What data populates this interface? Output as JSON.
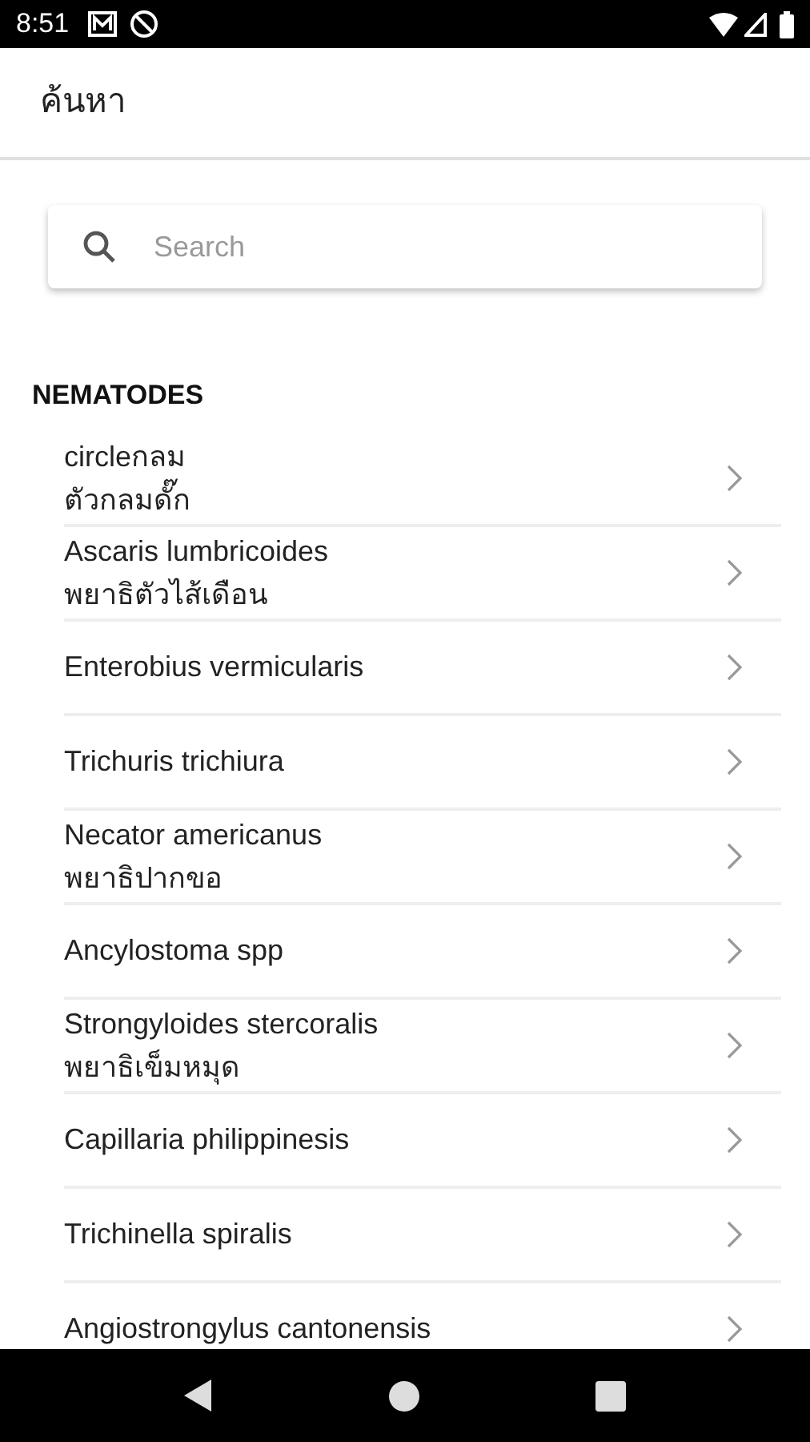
{
  "status_bar": {
    "time": "8:51"
  },
  "app_bar": {
    "title": "ค้นหา"
  },
  "search": {
    "placeholder": "Search"
  },
  "section": {
    "title": "NEMATODES"
  },
  "items": [
    {
      "title": "circleกลม",
      "subtitle": "ตัวกลมดั๊ก"
    },
    {
      "title": "Ascaris lumbricoides",
      "subtitle": "พยาธิตัวไส้เดือน"
    },
    {
      "title": "Enterobius vermicularis"
    },
    {
      "title": "Trichuris trichiura"
    },
    {
      "title": "Necator americanus",
      "subtitle": "พยาธิปากขอ"
    },
    {
      "title": "Ancylostoma spp"
    },
    {
      "title": "Strongyloides stercoralis",
      "subtitle": "พยาธิเข็มหมุด"
    },
    {
      "title": "Capillaria philippinesis"
    },
    {
      "title": "Trichinella spiralis"
    },
    {
      "title": "Angiostrongylus cantonensis"
    }
  ]
}
